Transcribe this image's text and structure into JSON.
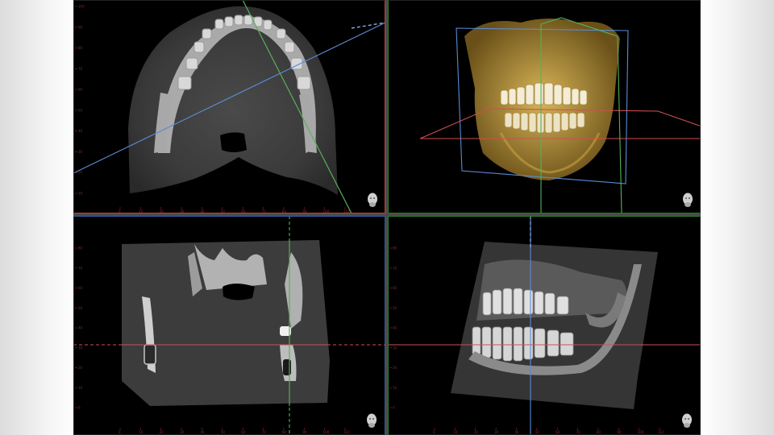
{
  "viewer": {
    "layout": "2x2",
    "crosshair_colors": {
      "axial": "#5a8bd6",
      "coronal": "#d05050",
      "sagittal": "#58b058"
    },
    "panes": [
      {
        "id": "axial",
        "view": "axial-slice",
        "orientation_icon": "head-orientation-icon"
      },
      {
        "id": "volume",
        "view": "3d-volume-rendering",
        "orientation_icon": "head-orientation-icon"
      },
      {
        "id": "coronal",
        "view": "coronal-slice",
        "orientation_icon": "head-orientation-icon"
      },
      {
        "id": "sagittal",
        "view": "sagittal-slice",
        "orientation_icon": "head-orientation-icon"
      }
    ]
  },
  "rulers": {
    "axial_x": [
      "0",
      "10",
      "20",
      "30",
      "40",
      "50",
      "60",
      "70",
      "80",
      "90",
      "100",
      "110"
    ],
    "axial_y": [
      "100",
      "90",
      "80",
      "70",
      "60",
      "50",
      "40",
      "30",
      "20",
      "10"
    ],
    "coronal_x": [
      "0",
      "10",
      "20",
      "30",
      "40",
      "50",
      "60",
      "70",
      "80",
      "90",
      "100",
      "110"
    ],
    "coronal_y": [
      "80",
      "70",
      "60",
      "50",
      "40",
      "30",
      "20",
      "10",
      "0"
    ],
    "sagittal_x": [
      "0",
      "10",
      "20",
      "30",
      "40",
      "50",
      "60",
      "70",
      "80",
      "90",
      "100",
      "110"
    ],
    "sagittal_y": [
      "80",
      "70",
      "60",
      "50",
      "40",
      "30",
      "20",
      "10",
      "0"
    ]
  }
}
